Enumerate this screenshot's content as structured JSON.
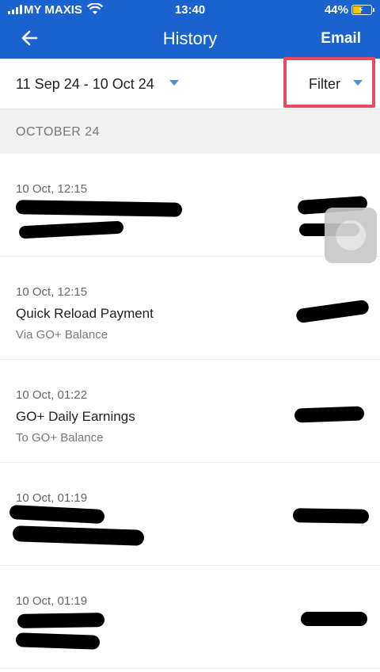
{
  "status_bar": {
    "carrier": "MY MAXIS",
    "time": "13:40",
    "battery": "44%"
  },
  "header": {
    "title": "History",
    "email_label": "Email"
  },
  "filter_bar": {
    "date_range": "11 Sep 24 - 10 Oct 24",
    "filter_label": "Filter"
  },
  "section": {
    "month": "OCTOBER 24"
  },
  "transactions": [
    {
      "timestamp": "10 Oct, 12:15",
      "name": "",
      "subtitle": ""
    },
    {
      "timestamp": "10 Oct, 12:15",
      "name": "Quick Reload Payment",
      "subtitle": "Via GO+ Balance"
    },
    {
      "timestamp": "10 Oct, 01:22",
      "name": "GO+ Daily Earnings",
      "subtitle": "To GO+ Balance"
    },
    {
      "timestamp": "10 Oct, 01:19",
      "name": "",
      "subtitle": ""
    },
    {
      "timestamp": "10 Oct, 01:19",
      "name": "",
      "subtitle": ""
    }
  ],
  "colors": {
    "header_bg": "#1a63cf",
    "highlight": "#e84a5f",
    "caret": "#4a8fe0"
  }
}
